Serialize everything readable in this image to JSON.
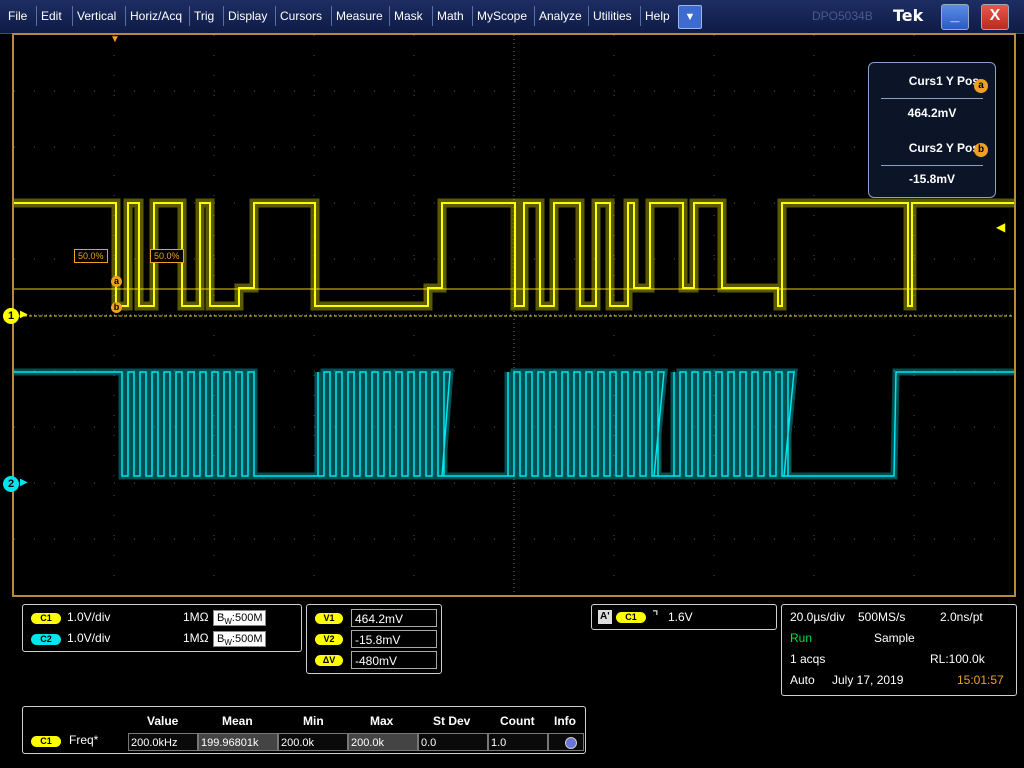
{
  "menu": {
    "items": [
      "File",
      "Edit",
      "Vertical",
      "Horiz/Acq",
      "Trig",
      "Display",
      "Cursors",
      "Measure",
      "Mask",
      "Math",
      "MyScope",
      "Analyze",
      "Utilities",
      "Help"
    ],
    "dropdown_icon": "chevron-down-icon",
    "ghost_brand": "DPO5034B",
    "brand": "Tek",
    "minimize": "_",
    "close": "X"
  },
  "graticule": {
    "ch1_label": "1",
    "ch2_label": "2",
    "cursor_a": "a",
    "cursor_b": "b",
    "pct_left": "50.0%",
    "pct_right": "50.0%"
  },
  "cursor_readout": {
    "curs1_title": "Curs1 Y Pos",
    "curs1_badge": "a",
    "curs1_value": "464.2mV",
    "curs2_title": "Curs2 Y Pos",
    "curs2_badge": "b",
    "curs2_value": "-15.8mV"
  },
  "channels": [
    {
      "tag": "C1",
      "scale": "1.0V/div",
      "impedance": "1MΩ",
      "bw_prefix": "B",
      "bw_sub": "W",
      "bw": ":500M",
      "color": "#ffff00"
    },
    {
      "tag": "C2",
      "scale": "1.0V/div",
      "impedance": "1MΩ",
      "bw_prefix": "B",
      "bw_sub": "W",
      "bw": ":500M",
      "color": "#00e5ee"
    }
  ],
  "cursor_values": {
    "v1_tag": "V1",
    "v1": "464.2mV",
    "v2_tag": "V2",
    "v2": "-15.8mV",
    "dv_tag": "ΔV",
    "dv": "-480mV"
  },
  "trigger": {
    "mode_tag": "A'",
    "source": "C1",
    "slope_icon": "falling-edge-icon",
    "level": "1.6V"
  },
  "acquisition": {
    "timebase": "20.0µs/div",
    "sample_rate": "500MS/s",
    "resolution": "2.0ns/pt",
    "state": "Run",
    "mode": "Sample",
    "acqs": "1 acqs",
    "record_length": "RL:100.0k",
    "trigger_mode": "Auto",
    "date": "July 17, 2019",
    "time": "15:01:57",
    "run_color": "#00e040",
    "time_color": "#f0a020"
  },
  "measurements": {
    "headers": [
      "Value",
      "Mean",
      "Min",
      "Max",
      "St Dev",
      "Count",
      "Info"
    ],
    "rows": [
      {
        "source": "C1",
        "name": "Freq*",
        "value": "200.0kHz",
        "mean": "199.96801k",
        "min": "200.0k",
        "max": "200.0k",
        "stdev": "0.0",
        "count": "1.0",
        "info_icon": "info-icon"
      }
    ]
  }
}
